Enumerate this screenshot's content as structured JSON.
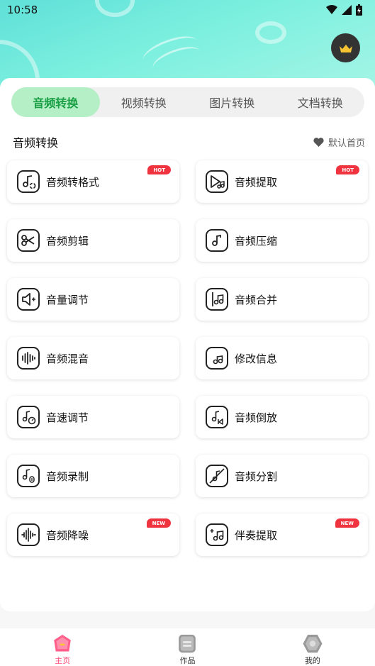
{
  "status": {
    "time": "10:58"
  },
  "tabs": [
    {
      "label": "音频转换",
      "active": true
    },
    {
      "label": "视频转换",
      "active": false
    },
    {
      "label": "图片转换",
      "active": false
    },
    {
      "label": "文档转换",
      "active": false
    }
  ],
  "section": {
    "title": "音频转换",
    "favorite_label": "默认首页"
  },
  "tools": [
    {
      "label": "音频转格式",
      "badge": "HOT",
      "icon": "note-convert-icon"
    },
    {
      "label": "音频提取",
      "badge": "HOT",
      "icon": "video-note-icon"
    },
    {
      "label": "音频剪辑",
      "badge": "",
      "icon": "scissors-icon"
    },
    {
      "label": "音频压缩",
      "badge": "",
      "icon": "note-compress-icon"
    },
    {
      "label": "音量调节",
      "badge": "",
      "icon": "speaker-volume-icon"
    },
    {
      "label": "音频合并",
      "badge": "",
      "icon": "note-merge-icon"
    },
    {
      "label": "音频混音",
      "badge": "",
      "icon": "waveform-mix-icon"
    },
    {
      "label": "修改信息",
      "badge": "",
      "icon": "note-info-icon"
    },
    {
      "label": "音速调节",
      "badge": "",
      "icon": "note-speed-icon"
    },
    {
      "label": "音频倒放",
      "badge": "",
      "icon": "note-reverse-icon"
    },
    {
      "label": "音频录制",
      "badge": "",
      "icon": "note-mic-icon"
    },
    {
      "label": "音频分割",
      "badge": "",
      "icon": "note-split-icon"
    },
    {
      "label": "音频降噪",
      "badge": "NEW",
      "icon": "waveform-denoise-icon"
    },
    {
      "label": "伴奏提取",
      "badge": "NEW",
      "icon": "accompaniment-icon"
    }
  ],
  "nav": [
    {
      "label": "主页",
      "active": true
    },
    {
      "label": "作品",
      "active": false
    },
    {
      "label": "我的",
      "active": false
    }
  ],
  "colors": {
    "accent": "#1a9f45",
    "tab_active_bg": "#b5efc6",
    "badge": "#f0343f",
    "nav_active": "#ff4f7a"
  }
}
